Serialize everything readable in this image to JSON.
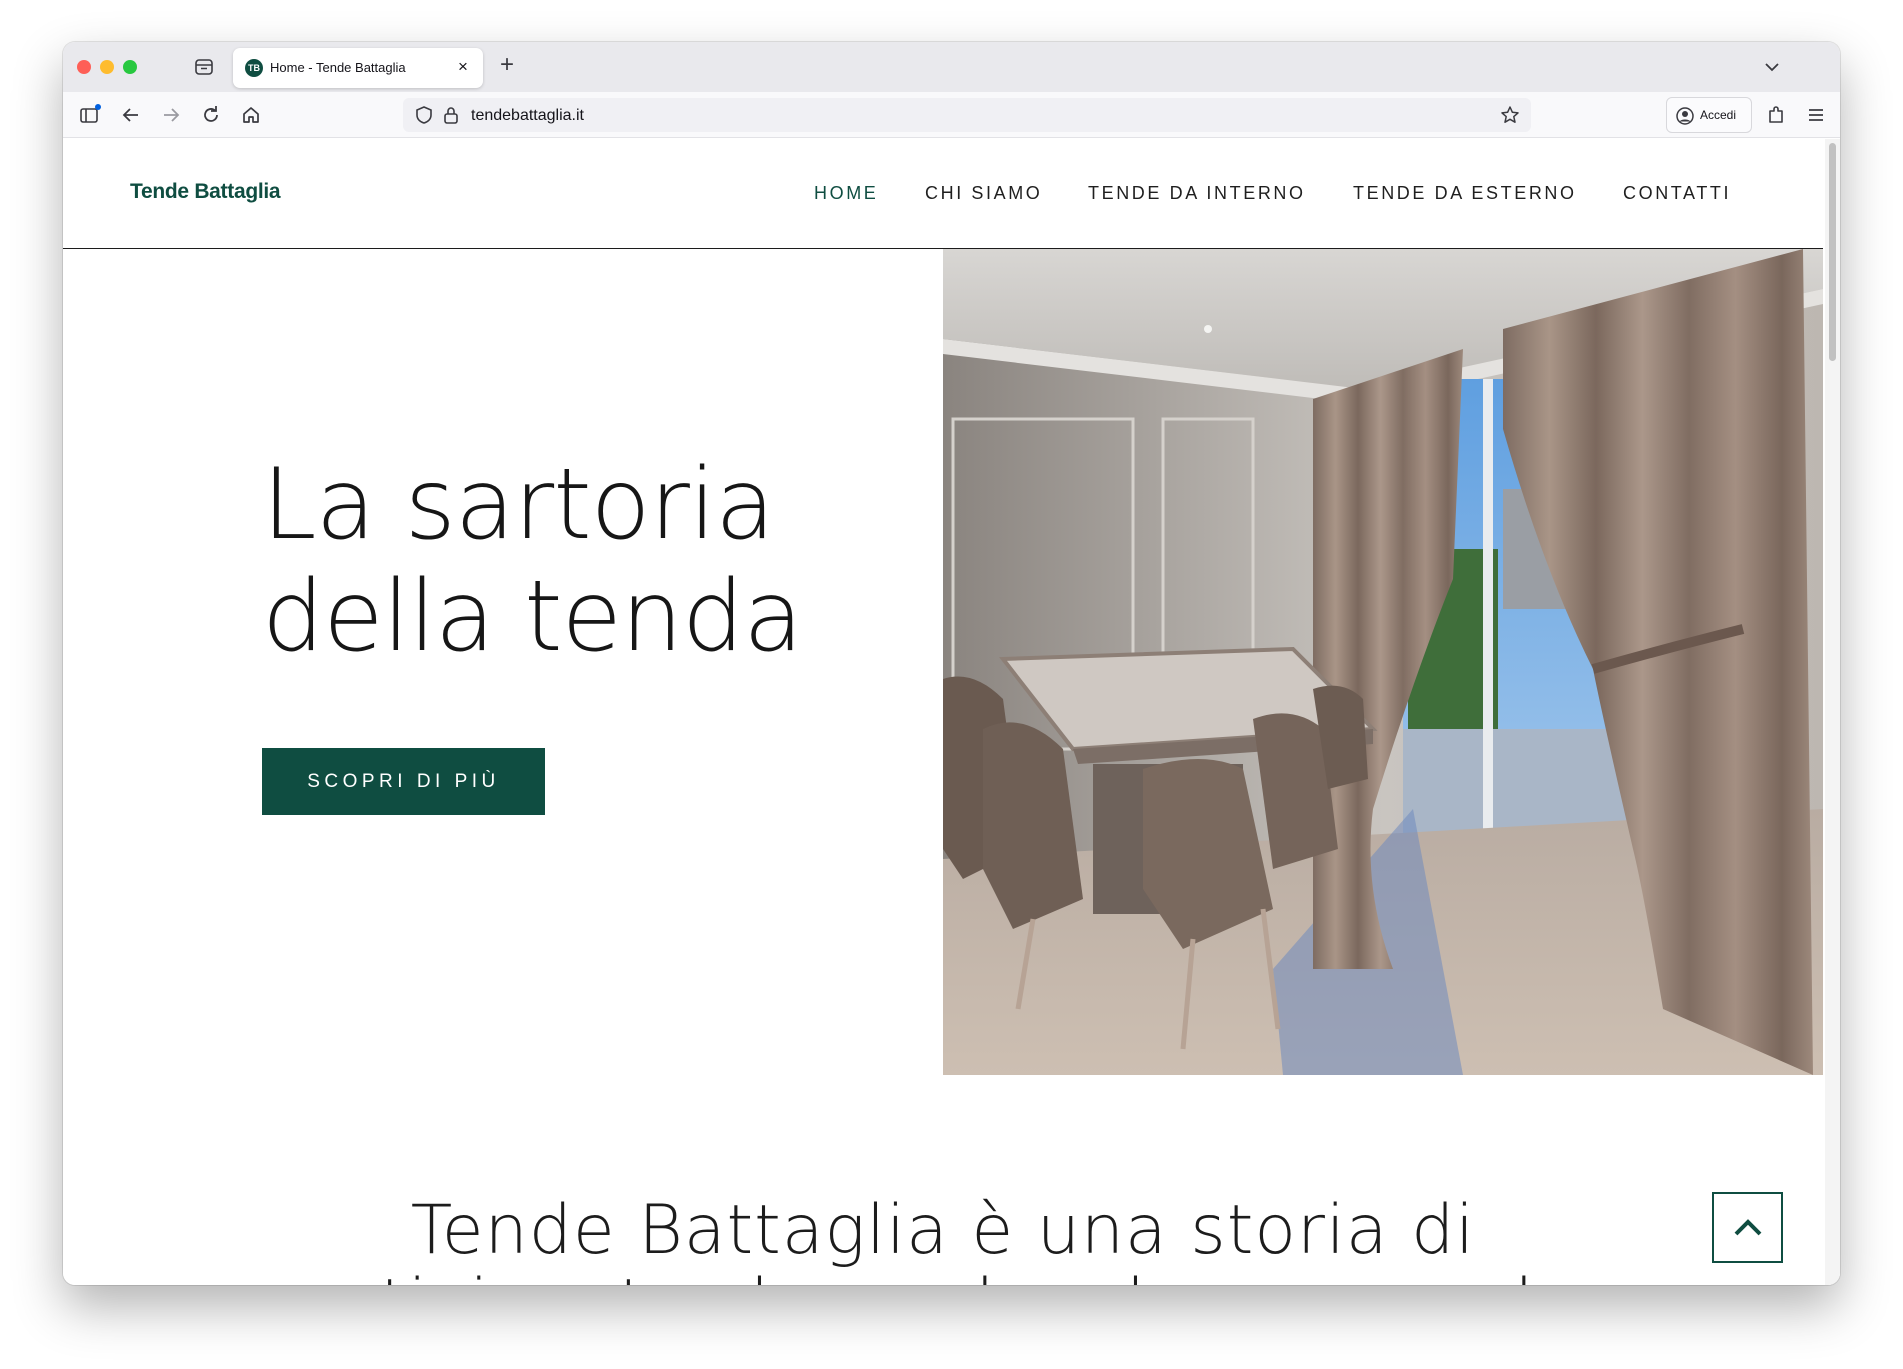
{
  "browser": {
    "tab_title": "Home - Tende Battaglia",
    "tab_favicon_text": "TB",
    "url": "tendebattaglia.it",
    "accedi_label": "Accedi",
    "icons": [
      "tabs-overview-icon",
      "close-tab-icon",
      "new-tab-icon",
      "tab-list-chevron-icon",
      "sidebar-icon",
      "back-icon",
      "forward-icon",
      "reload-icon",
      "home-icon",
      "shield-icon",
      "lock-icon",
      "bookmark-star-icon",
      "account-icon",
      "extensions-icon",
      "menu-icon"
    ]
  },
  "site": {
    "logo": "Tende Battaglia",
    "nav": [
      {
        "label": "HOME",
        "active": true
      },
      {
        "label": "CHI SIAMO",
        "active": false
      },
      {
        "label": "TENDE DA INTERNO",
        "active": false
      },
      {
        "label": "TENDE DA ESTERNO",
        "active": false
      },
      {
        "label": "CONTATTI",
        "active": false
      }
    ],
    "hero": {
      "title_line1": "La sartoria",
      "title_line2": "della tenda",
      "button_label": "SCOPRI DI PIÙ"
    },
    "intro_line1": "Tende Battaglia è una storia di",
    "intro_line2": "artigianato che parla e lavora con le",
    "colors": {
      "brand_green": "#0f4d41",
      "text": "#161616"
    }
  }
}
